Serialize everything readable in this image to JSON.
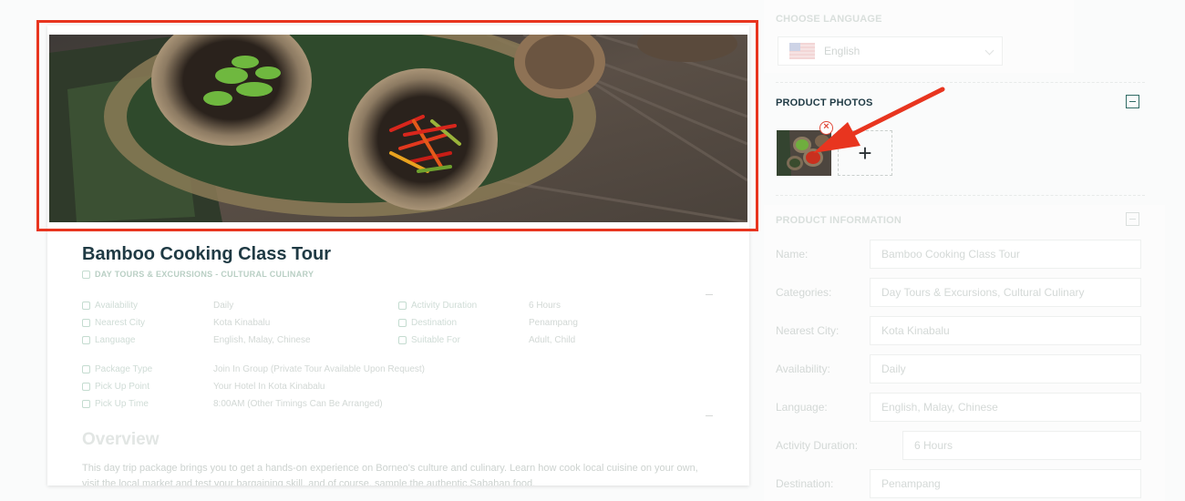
{
  "preview": {
    "title": "Bamboo Cooking Class Tour",
    "categories": "DAY TOURS & EXCURSIONS - CULTURAL CULINARY",
    "details_left": [
      {
        "label": "Availability",
        "value": "Daily"
      },
      {
        "label": "Nearest City",
        "value": "Kota Kinabalu"
      },
      {
        "label": "Language",
        "value": "English, Malay, Chinese"
      }
    ],
    "details_right": [
      {
        "label": "Activity Duration",
        "value": "6 Hours"
      },
      {
        "label": "Destination",
        "value": "Penampang"
      },
      {
        "label": "Suitable For",
        "value": "Adult, Child"
      }
    ],
    "details_package": [
      {
        "label": "Package Type",
        "value": "Join In Group (Private Tour Available Upon Request)"
      },
      {
        "label": "Pick Up Point",
        "value": "Your Hotel In Kota Kinabalu"
      },
      {
        "label": "Pick Up Time",
        "value": "8:00AM (Other Timings Can Be Arranged)"
      }
    ],
    "overview_heading": "Overview",
    "overview_text": "This day trip package brings you to get a hands-on experience on Borneo's culture and culinary. Learn how cook local cuisine on your own, visit the local market and test your bargaining skill, and of course, sample the authentic Sabahan food."
  },
  "sidebar": {
    "language": {
      "heading": "CHOOSE LANGUAGE",
      "selected": "English",
      "flag_icon": "us-flag-icon"
    },
    "photos": {
      "heading": "PRODUCT PHOTOS",
      "add_label": "+"
    },
    "info": {
      "heading": "PRODUCT INFORMATION",
      "fields": [
        {
          "label": "Name:",
          "value": "Bamboo Cooking Class Tour"
        },
        {
          "label": "Categories:",
          "value": "Day Tours & Excursions, Cultural Culinary"
        },
        {
          "label": "Nearest City:",
          "value": "Kota Kinabalu"
        },
        {
          "label": "Availability:",
          "value": "Daily"
        },
        {
          "label": "Language:",
          "value": "English, Malay, Chinese"
        },
        {
          "label": "Activity Duration:",
          "value": "6 Hours"
        },
        {
          "label": "Destination:",
          "value": "Penampang"
        }
      ]
    }
  },
  "colors": {
    "annotation": "#e8351f",
    "accent": "#2f6b64",
    "title": "#1f3a44"
  }
}
